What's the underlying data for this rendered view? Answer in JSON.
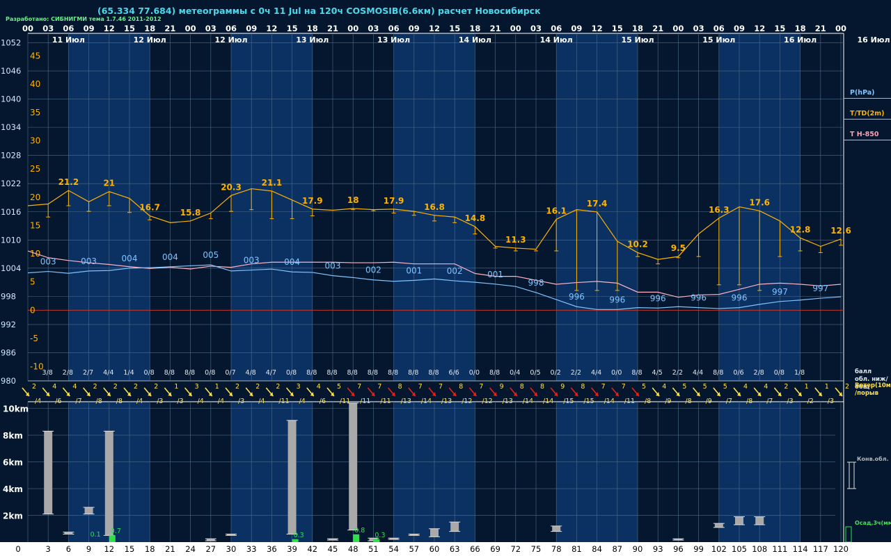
{
  "header": {
    "title": "(65.334 77.684) метеограммы с  0ч 11 Jul на 120ч COSMOSIB(6.6км) расчет Новосибирск",
    "credit": "Разработано: СИБНИГМИ тема 1.7.46 2011-2012"
  },
  "legend": {
    "pressure": "P(hPa)",
    "temperature": "T/TD(2m)",
    "h850": "T H-850",
    "cloud": "балл обл. ниж/общ",
    "wind": "Ветер(10м) /порыв",
    "conv": "Конв.обл.",
    "precip": "Осад,3ч(мм)"
  },
  "colors": {
    "background": "#04172e",
    "band": "#0b3163",
    "grid": "#4f6d8a",
    "pressure": "#7fc4ff",
    "temperature": "#ffb300",
    "h850": "#ffb3c2",
    "wind_normal": "#ffe14d",
    "wind_strong": "#e8221a",
    "convective_cloud": "#a9a9a9",
    "precipitation": "#2fe04a"
  },
  "chart_data": [
    {
      "type": "line",
      "title": "",
      "hours_utc_labels": [
        "00",
        "03",
        "06",
        "09",
        "12",
        "15",
        "18",
        "21",
        "00",
        "03",
        "06",
        "09",
        "12",
        "15",
        "18",
        "21",
        "00",
        "03",
        "06",
        "09",
        "12",
        "15",
        "18",
        "21",
        "00",
        "03",
        "06",
        "09",
        "12",
        "15",
        "18",
        "21",
        "00",
        "03",
        "06",
        "09",
        "12",
        "15",
        "18",
        "21",
        "00"
      ],
      "day_labels": [
        "11 Июл",
        "12 Июл",
        "12 Июл",
        "13 Июл",
        "13 Июл",
        "14 Июл",
        "14 Июл",
        "15 Июл",
        "15 Июл",
        "16 Июл",
        "16 Июл"
      ],
      "pressure_axis_ticks": [
        1052,
        1046,
        1040,
        1034,
        1028,
        1022,
        1016,
        1010,
        1004,
        998,
        992,
        986,
        980
      ],
      "temperature_axis_ticks": [
        45,
        40,
        35,
        30,
        25,
        20,
        15,
        10,
        5,
        0,
        -5,
        -10
      ],
      "ylim_pressure": [
        980,
        1054
      ],
      "ylim_temperature": [
        -12.5,
        49
      ],
      "series": [
        {
          "name": "T/TD(2m)",
          "unit": "°C",
          "values": [
            18.5,
            18.8,
            21.2,
            19.2,
            21,
            19.8,
            16.7,
            15.5,
            15.8,
            17.2,
            20.3,
            21.5,
            21.1,
            19.5,
            17.9,
            17.7,
            18,
            17.8,
            17.9,
            17.5,
            16.8,
            16.5,
            14.8,
            11.3,
            11.0,
            10.8,
            16.1,
            17.8,
            17.4,
            12.2,
            10.2,
            9.0,
            9.5,
            13.5,
            16.3,
            18.3,
            17.6,
            15.8,
            12.8,
            11.3,
            12.6
          ]
        },
        {
          "name": "T/TD(2m) lower",
          "unit": "°C",
          "values": [
            null,
            16.5,
            18.5,
            17.5,
            18.5,
            17.3,
            16.0,
            null,
            null,
            16.2,
            17.5,
            17.8,
            16.2,
            16.2,
            16.7,
            null,
            17.8,
            17.6,
            17.2,
            16.8,
            15.8,
            15.5,
            13.5,
            11.0,
            10.5,
            10.5,
            10.5,
            3.5,
            3.5,
            3.5,
            9.5,
            8.2,
            9.3,
            9.5,
            4.5,
            4.5,
            3.5,
            9.5,
            10.5,
            10.2,
            11.5
          ]
        },
        {
          "name": "P(hPa)",
          "unit": "hPa",
          "labels": [
            "003",
            "003",
            "004",
            "004",
            "005",
            "003",
            "004",
            "003",
            "002",
            "001",
            "002",
            "001",
            "998",
            "996",
            "996",
            "996",
            "996",
            "996",
            "997",
            "997"
          ],
          "values": [
            1003.0,
            1003.3,
            1002.9,
            1003.4,
            1003.5,
            1004.0,
            1004.1,
            1004.3,
            1004.5,
            1004.7,
            1003.4,
            1003.6,
            1003.8,
            1003.2,
            1003.1,
            1002.4,
            1002.0,
            1001.5,
            1001.2,
            1001.4,
            1001.7,
            1001.3,
            1001.0,
            1000.6,
            1000.1,
            998.8,
            997.3,
            995.8,
            995.2,
            995.2,
            995.6,
            995.5,
            995.8,
            995.6,
            995.4,
            995.6,
            996.3,
            996.9,
            997.2,
            997.6,
            997.9
          ]
        },
        {
          "name": "T H-850",
          "unit": "°C",
          "values": [
            10.5,
            9.3,
            8.8,
            8.4,
            8.1,
            7.7,
            7.4,
            7.6,
            7.3,
            7.8,
            7.6,
            8.2,
            8.5,
            8.5,
            8.5,
            8.5,
            8.4,
            8.4,
            8.5,
            8.2,
            8.2,
            8.2,
            6.5,
            6.0,
            6.0,
            5.3,
            4.6,
            4.9,
            5.1,
            4.8,
            3.2,
            3.2,
            2.3,
            2.7,
            2.8,
            3.7,
            4.6,
            4.8,
            4.6,
            4.3,
            4.6
          ]
        }
      ],
      "value_labels": {
        "temperature_max": [
          {
            "h": 6,
            "text": "21.2"
          },
          {
            "h": 12,
            "text": "21"
          },
          {
            "h": 18,
            "text": "16.7"
          },
          {
            "h": 24,
            "text": "15.8"
          },
          {
            "h": 30,
            "text": "20.3"
          },
          {
            "h": 36,
            "text": "21.1"
          },
          {
            "h": 42,
            "text": "17.9"
          },
          {
            "h": 48,
            "text": "18"
          },
          {
            "h": 54,
            "text": "17.9"
          },
          {
            "h": 60,
            "text": "16.8"
          },
          {
            "h": 66,
            "text": "14.8"
          },
          {
            "h": 72,
            "text": "11.3"
          },
          {
            "h": 78,
            "text": "16.1"
          },
          {
            "h": 84,
            "text": "17.4"
          },
          {
            "h": 90,
            "text": "10.2"
          },
          {
            "h": 96,
            "text": "9.5"
          },
          {
            "h": 102,
            "text": "16.3"
          },
          {
            "h": 108,
            "text": "17.6"
          },
          {
            "h": 114,
            "text": "12.8"
          },
          {
            "h": 120,
            "text": "12.6"
          }
        ],
        "pressure": [
          {
            "h": 3,
            "text": "003"
          },
          {
            "h": 9,
            "text": "003"
          },
          {
            "h": 15,
            "text": "004"
          },
          {
            "h": 21,
            "text": "004"
          },
          {
            "h": 27,
            "text": "005"
          },
          {
            "h": 33,
            "text": "003"
          },
          {
            "h": 39,
            "text": "004"
          },
          {
            "h": 45,
            "text": "003"
          },
          {
            "h": 51,
            "text": "002"
          },
          {
            "h": 57,
            "text": "001"
          },
          {
            "h": 63,
            "text": "002"
          },
          {
            "h": 69,
            "text": "001"
          },
          {
            "h": 75,
            "text": "998"
          },
          {
            "h": 81,
            "text": "996"
          },
          {
            "h": 87,
            "text": "996"
          },
          {
            "h": 93,
            "text": "996"
          },
          {
            "h": 99,
            "text": "996"
          },
          {
            "h": 105,
            "text": "996"
          },
          {
            "h": 111,
            "text": "997"
          },
          {
            "h": 117,
            "text": "997"
          }
        ]
      }
    },
    {
      "type": "table",
      "title": "",
      "cloud_cover": [
        "3/8",
        "2/8",
        "2/7",
        "4/4",
        "1/4",
        "0/8",
        "8/8",
        "8/8",
        "0/8",
        "0/7",
        "4/8",
        "4/7",
        "0/8",
        "8/8",
        "8/8",
        "8/8",
        "8/8",
        "8/8",
        "8/8",
        "8/8",
        "6/6",
        "0/0",
        "8/8",
        "0/4",
        "0/5",
        "0/2",
        "2/2",
        "4/4",
        "0/0",
        "8/8",
        "4/5",
        "2/2",
        "4/4",
        "8/8",
        "0/6",
        "2/8",
        "0/8",
        "1/8"
      ],
      "wind_speed_top": [
        "2",
        "4",
        "4",
        "2",
        "2",
        "2",
        "2",
        "1",
        "3",
        "1",
        "2",
        "2",
        "2",
        "3",
        "4",
        "5",
        "7",
        "7",
        "8",
        "7",
        "7",
        "8",
        "7",
        "9",
        "8",
        "8",
        "9",
        "8",
        "7",
        "7",
        "5",
        "4",
        "5",
        "5",
        "5",
        "4",
        "4",
        "2",
        "1",
        "1",
        "2"
      ],
      "wind_gust_bottom": [
        "/4",
        "/6",
        "/7",
        "/8",
        "/8",
        "/4",
        "/3",
        "/3",
        "/4",
        "/4",
        "/3",
        "/4",
        "/11",
        "/4",
        "/6",
        "/11",
        "/11",
        "/11",
        "/13",
        "/14",
        "/13",
        "/12",
        "/12",
        "/13",
        "/14",
        "/14",
        "/15",
        "/15",
        "/14",
        "/11",
        "/8",
        "/9",
        "/8",
        "/9",
        "/7",
        "/8",
        "/7",
        "/3",
        "/2",
        "/3"
      ],
      "wind_strong_from_index": 16,
      "wind_strong_to_index": 30
    },
    {
      "type": "bar",
      "title": "",
      "ylabel": "км",
      "y_ticks": [
        "10km",
        "8km",
        "6km",
        "4km",
        "2km"
      ],
      "x_ticks": [
        "0",
        "3",
        "6",
        "9",
        "12",
        "15",
        "18",
        "21",
        "24",
        "27",
        "30",
        "33",
        "36",
        "39",
        "42",
        "45",
        "48",
        "51",
        "54",
        "57",
        "60",
        "63",
        "66",
        "69",
        "72",
        "75",
        "78",
        "81",
        "84",
        "87",
        "90",
        "93",
        "96",
        "99",
        "102",
        "105",
        "108",
        "111",
        "114",
        "117",
        "120"
      ],
      "ylim": [
        0,
        10.5
      ],
      "convective_clouds": [
        {
          "h": 3,
          "bottom": 2.1,
          "top": 8.3
        },
        {
          "h": 6,
          "bottom": 0.6,
          "top": 0.75
        },
        {
          "h": 9,
          "bottom": 2.1,
          "top": 2.6
        },
        {
          "h": 12,
          "bottom": 0.5,
          "top": 8.3
        },
        {
          "h": 27,
          "bottom": 0.1,
          "top": 0.25
        },
        {
          "h": 30,
          "bottom": 0.5,
          "top": 0.6
        },
        {
          "h": 39,
          "bottom": 0.6,
          "top": 9.1
        },
        {
          "h": 45,
          "bottom": 0.15,
          "top": 0.25
        },
        {
          "h": 48,
          "bottom": 0.9,
          "top": 10.4
        },
        {
          "h": 51,
          "bottom": 0.1,
          "top": 0.3
        },
        {
          "h": 54,
          "bottom": 0.2,
          "top": 0.3
        },
        {
          "h": 57,
          "bottom": 0.5,
          "top": 0.6
        },
        {
          "h": 60,
          "bottom": 0.4,
          "top": 1.0
        },
        {
          "h": 63,
          "bottom": 0.8,
          "top": 1.5
        },
        {
          "h": 78,
          "bottom": 0.8,
          "top": 1.2
        },
        {
          "h": 96,
          "bottom": 0.15,
          "top": 0.25
        },
        {
          "h": 102,
          "bottom": 1.1,
          "top": 1.4
        },
        {
          "h": 105,
          "bottom": 1.3,
          "top": 1.9
        },
        {
          "h": 108,
          "bottom": 1.3,
          "top": 1.9
        }
      ],
      "precipitation_mm": [
        {
          "h": 12,
          "value": 0.7,
          "label": "0.7"
        },
        {
          "h": 39,
          "value": 0.3,
          "label": "0.3"
        },
        {
          "h": 48,
          "value": 0.8,
          "label": "0.8"
        },
        {
          "h": 51,
          "value": 0.3,
          "label": "0.3"
        }
      ],
      "precip_label_extra": {
        "h": 9,
        "label": "0.1"
      }
    }
  ]
}
